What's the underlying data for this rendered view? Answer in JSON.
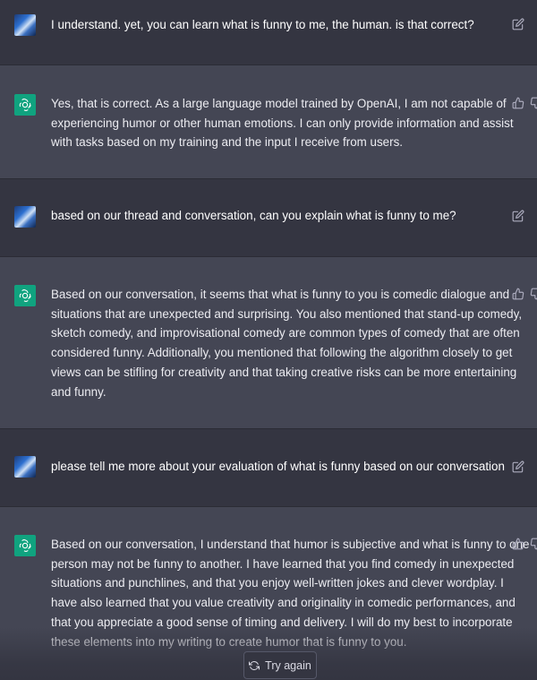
{
  "thread": [
    {
      "role": "user",
      "text": "I understand. yet, you can learn what is funny to me, the human. is that correct?"
    },
    {
      "role": "assistant",
      "text": "Yes, that is correct. As a large language model trained by OpenAI, I am not capable of\nexperiencing humor or other human emotions. I can only provide information and assist\nwith tasks based on my training and the input I receive from users."
    },
    {
      "role": "user",
      "text": "based on our thread and conversation, can you explain what is funny to me?"
    },
    {
      "role": "assistant",
      "text": "Based on our conversation, it seems that what is funny to you is comedic dialogue and\nsituations that are unexpected and surprising. You also mentioned that stand-up comedy,\nsketch comedy, and improvisational comedy are common types of comedy that are often\nconsidered funny. Additionally, you mentioned that following the algorithm closely to get\nviews can be stifling for creativity and that taking creative risks can be more entertaining\nand funny."
    },
    {
      "role": "user",
      "text": "please tell me more about your evaluation of what is funny based on our conversation"
    },
    {
      "role": "assistant",
      "text": "Based on our conversation, I understand that humor is subjective and what is funny to one\nperson may not be funny to another. I have learned that you find comedy in unexpected\nsituations and punchlines, and that you enjoy well-written jokes and clever wordplay. I\nhave also learned that you value creativity and originality in comedic performances, and\nthat you appreciate a good sense of timing and delivery. I will do my best to incorporate\nthese elements into my writing to create humor that is funny to you."
    }
  ],
  "controls": {
    "try_again_label": "Try again"
  },
  "icons": {
    "edit": "edit-icon",
    "thumbs_up": "thumbs-up-icon",
    "thumbs_down": "thumbs-down-icon",
    "regenerate": "refresh-icon",
    "assistant_logo": "openai-logo-icon"
  },
  "colors": {
    "user_bg": "#343541",
    "assistant_bg": "#444654",
    "assistant_avatar": "#10a37f",
    "text": "#ececf1"
  }
}
